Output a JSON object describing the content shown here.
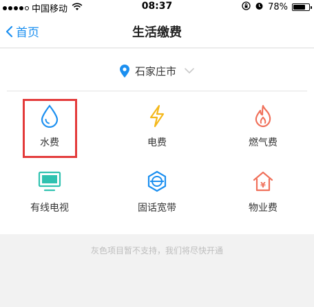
{
  "status_bar": {
    "carrier": "中国移动",
    "time": "08:37",
    "battery": "78%",
    "battery_level": 0.78
  },
  "nav": {
    "back_label": "首页",
    "title": "生活缴费"
  },
  "city": {
    "name": "石家庄市"
  },
  "services": [
    {
      "label": "水费",
      "icon": "water-drop-icon",
      "color": "#1b8ff0"
    },
    {
      "label": "电费",
      "icon": "lightning-icon",
      "color": "#f4b81b"
    },
    {
      "label": "燃气费",
      "icon": "flame-icon",
      "color": "#f0705a"
    },
    {
      "label": "有线电视",
      "icon": "tv-icon",
      "color": "#2fc2b0"
    },
    {
      "label": "固话宽带",
      "icon": "broadband-icon",
      "color": "#1b8ff0"
    },
    {
      "label": "物业费",
      "icon": "house-yuan-icon",
      "color": "#f0705a"
    }
  ],
  "footer_note": "灰色项目暂不支持，我们将尽快开通"
}
